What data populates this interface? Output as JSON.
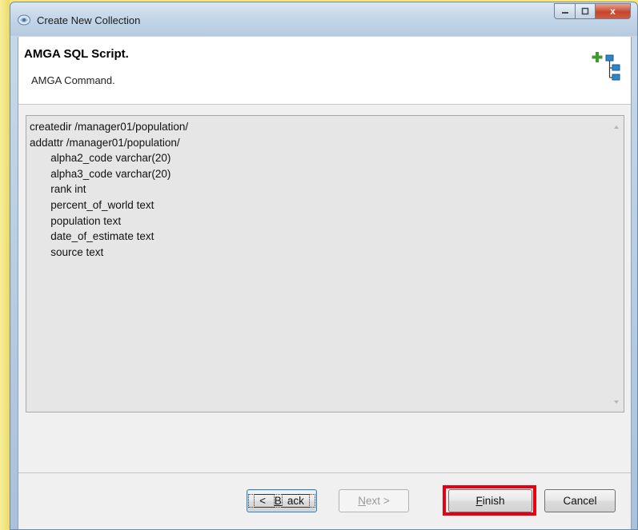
{
  "window": {
    "title": "Create New Collection",
    "controls": {
      "close": "x"
    }
  },
  "header": {
    "title": "AMGA SQL Script.",
    "description": "AMGA Command.",
    "icon": "add-tree-icon"
  },
  "script": {
    "lines": [
      "createdir /manager01/population/",
      "addattr /manager01/population/",
      "       alpha2_code varchar(20)",
      "       alpha3_code varchar(20)",
      "       rank int",
      "       percent_of_world text",
      "       population text",
      "       date_of_estimate text",
      "       source text"
    ]
  },
  "buttons": {
    "back": {
      "mnemonic": "B",
      "label_rest": "ack",
      "prefix": "< "
    },
    "next": {
      "mnemonic": "N",
      "label_rest": "ext",
      "suffix": " >",
      "enabled": false
    },
    "finish": {
      "mnemonic": "F",
      "label_rest": "inish",
      "highlighted": true
    },
    "cancel": {
      "label": "Cancel"
    }
  },
  "colors": {
    "highlight": "#e60012",
    "background": "#f7e77a"
  }
}
